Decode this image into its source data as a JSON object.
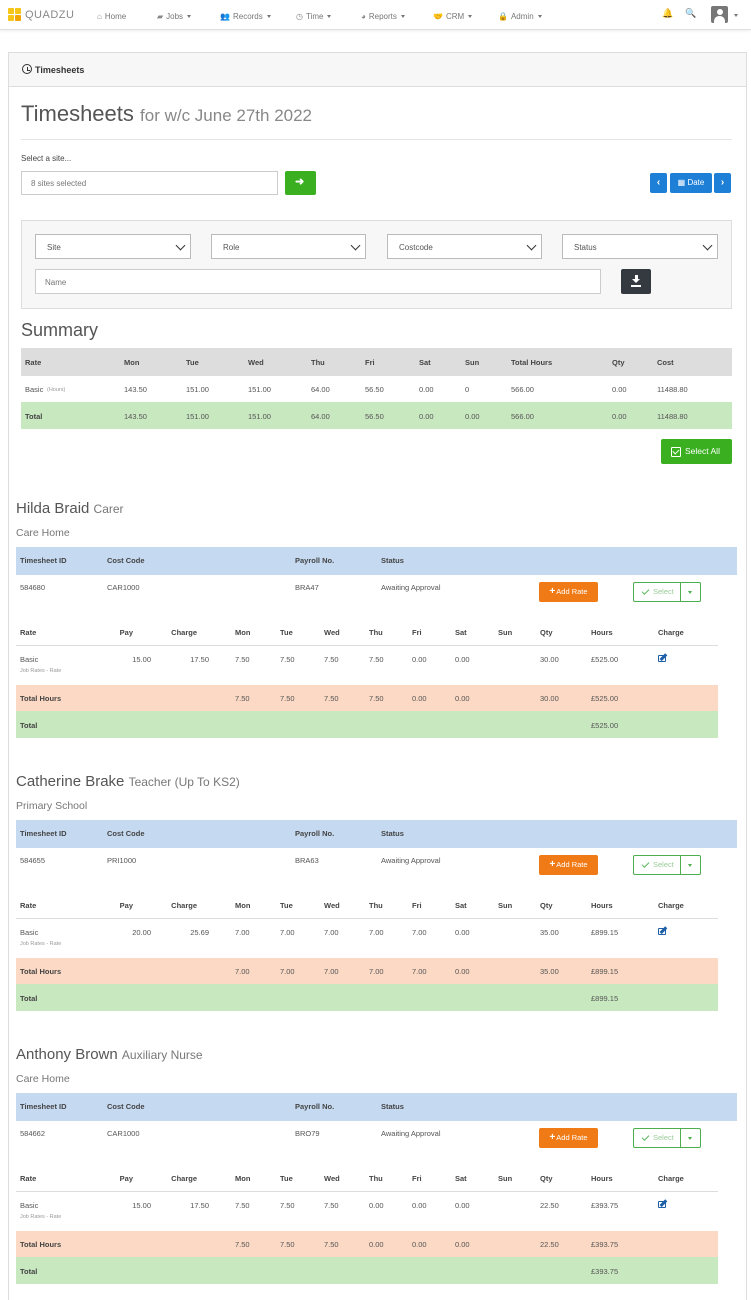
{
  "nav": {
    "brand": "QUADZU",
    "items": [
      {
        "label": "Home",
        "icon": "home-icon",
        "caret": false
      },
      {
        "label": "Jobs",
        "icon": "briefcase-icon",
        "caret": true
      },
      {
        "label": "Records",
        "icon": "users-icon",
        "caret": true
      },
      {
        "label": "Time",
        "icon": "clock-icon",
        "caret": true
      },
      {
        "label": "Reports",
        "icon": "pie-chart-icon",
        "caret": true
      },
      {
        "label": "CRM",
        "icon": "handshake-icon",
        "caret": true
      },
      {
        "label": "Admin",
        "icon": "lock-icon",
        "caret": true
      }
    ]
  },
  "card": {
    "title": "Timesheets"
  },
  "page": {
    "title": "Timesheets",
    "subtitle": "for w/c June 27th 2022",
    "select_site_label": "Select a site...",
    "site_input_value": "8 sites selected",
    "date_button": "Date",
    "prev_glyph": "‹",
    "next_glyph": "›",
    "go_glyph": "➜"
  },
  "filters": {
    "selects": [
      "Site",
      "Role",
      "Costcode",
      "Status"
    ],
    "name_placeholder": "Name"
  },
  "summary": {
    "heading": "Summary",
    "columns": [
      "Rate",
      "Mon",
      "Tue",
      "Wed",
      "Thu",
      "Fri",
      "Sat",
      "Sun",
      "Total Hours",
      "Qty",
      "Cost"
    ],
    "rows": [
      {
        "rate": "Basic",
        "note": "(Hours)",
        "values": [
          "143.50",
          "151.00",
          "151.00",
          "64.00",
          "56.50",
          "0.00",
          "0",
          "566.00",
          "0.00",
          "11488.80"
        ]
      }
    ],
    "total": {
      "label": "Total",
      "values": [
        "143.50",
        "151.00",
        "151.00",
        "64.00",
        "56.50",
        "0.00",
        "0.00",
        "566.00",
        "0.00",
        "11488.80"
      ]
    },
    "select_all": "Select All"
  },
  "timesheet_headers": [
    "Timesheet ID",
    "Cost Code",
    "Payroll No.",
    "Status"
  ],
  "rate_headers": [
    "Rate",
    "Pay",
    "Charge",
    "Mon",
    "Tue",
    "Wed",
    "Thu",
    "Fri",
    "Sat",
    "Sun",
    "Qty",
    "Hours",
    "Charge"
  ],
  "add_rate_label": "Add Rate",
  "select_label": "Select",
  "total_hours_label": "Total Hours",
  "total_label": "Total",
  "employees": [
    {
      "name": "Hilda Braid",
      "role": "Carer",
      "site": "Care Home",
      "timesheet_id": "584680",
      "cost_code": "CAR1000",
      "payroll": "BRA47",
      "status": "Awaiting Approval",
      "rate": {
        "name": "Basic",
        "note": "Job Rates - Rate",
        "pay": "15.00",
        "charge": "17.50",
        "days": [
          "7.50",
          "7.50",
          "7.50",
          "7.50",
          "0.00",
          "0.00",
          ""
        ],
        "qty": "30.00",
        "hours": "£525.00"
      },
      "total_hours": {
        "days": [
          "7.50",
          "7.50",
          "7.50",
          "7.50",
          "0.00",
          "0.00",
          ""
        ],
        "qty": "30.00",
        "hours": "£525.00"
      },
      "total": "£525.00"
    },
    {
      "name": "Catherine Brake",
      "role": "Teacher (Up To KS2)",
      "site": "Primary School",
      "timesheet_id": "584655",
      "cost_code": "PRI1000",
      "payroll": "BRA63",
      "status": "Awaiting Approval",
      "rate": {
        "name": "Basic",
        "note": "Job Rates - Rate",
        "pay": "20.00",
        "charge": "25.69",
        "days": [
          "7.00",
          "7.00",
          "7.00",
          "7.00",
          "7.00",
          "0.00",
          ""
        ],
        "qty": "35.00",
        "hours": "£899.15"
      },
      "total_hours": {
        "days": [
          "7.00",
          "7.00",
          "7.00",
          "7.00",
          "7.00",
          "0.00",
          ""
        ],
        "qty": "35.00",
        "hours": "£899.15"
      },
      "total": "£899.15"
    },
    {
      "name": "Anthony Brown",
      "role": "Auxiliary Nurse",
      "site": "Care Home",
      "timesheet_id": "584662",
      "cost_code": "CAR1000",
      "payroll": "BRO79",
      "status": "Awaiting Approval",
      "rate": {
        "name": "Basic",
        "note": "Job Rates - Rate",
        "pay": "15.00",
        "charge": "17.50",
        "days": [
          "7.50",
          "7.50",
          "7.50",
          "0.00",
          "0.00",
          "0.00",
          ""
        ],
        "qty": "22.50",
        "hours": "£393.75"
      },
      "total_hours": {
        "days": [
          "7.50",
          "7.50",
          "7.50",
          "0.00",
          "0.00",
          "0.00",
          ""
        ],
        "qty": "22.50",
        "hours": "£393.75"
      },
      "total": "£393.75"
    }
  ],
  "colors": {
    "header_grey": "#dddddd",
    "summary_total_green": "#c8e8c0",
    "timesheet_header_blue": "#c5d9f1",
    "total_hours_orange": "#fcd9c4",
    "total_green": "#c8e8c0",
    "primary_blue": "#1e7fd6",
    "success_green": "#3ab021",
    "add_rate_orange": "#f07b16"
  }
}
